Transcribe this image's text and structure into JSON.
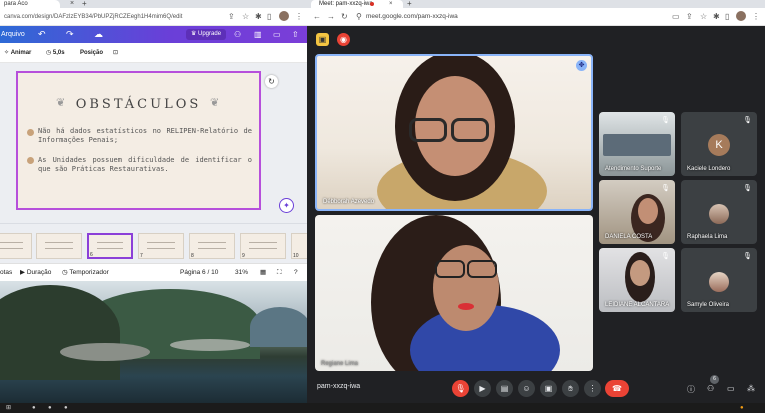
{
  "left_window": {
    "tab_title": "para Aco",
    "url": "canva.com/design/DAFzlzEYB34/PbUPZjRCZEegh1H4mim6Q/edit",
    "toolbar": {
      "file_label": "Arquivo",
      "upgrade_label": "Upgrade",
      "animate_label": "Animar",
      "duration_label": "5,0s",
      "position_label": "Posição"
    },
    "slide": {
      "title": "OBSTÁCULOS",
      "bullets": [
        "Não há dados estatísticos no RELIPEN-Relatório de Informações Penais;",
        "As Unidades possuem dificuldade de identificar o que são Práticas Restaurativas."
      ]
    },
    "thumbnails": [
      "5",
      "6",
      "7",
      "8",
      "9",
      "10"
    ],
    "bottom_bar": {
      "notes_label": "otas",
      "duration_label": "Duração",
      "timer_label": "Temporizador",
      "page_label": "Página 6 / 10",
      "zoom_label": "31%"
    }
  },
  "right_window": {
    "tab_title": "Meet: pam-xxzq-iwa",
    "url": "meet.google.com/pam-xxzq-iwa",
    "main_participants": [
      {
        "name": "Débborah Azevedo"
      },
      {
        "name": "Regiane Lima"
      }
    ],
    "grid_participants": [
      {
        "name": "Atendimento Suporte",
        "initial": ""
      },
      {
        "name": "Kaciele Londero",
        "initial": "K"
      },
      {
        "name": "DANIELA COSTA",
        "initial": ""
      },
      {
        "name": "Raphaela Lima",
        "initial": ""
      },
      {
        "name": "LEIDIANE ALCANTARA",
        "initial": ""
      },
      {
        "name": "Samyle Oliveira",
        "initial": ""
      }
    ],
    "meeting_code": "pam-xxzq-iwa",
    "participant_count": "6"
  },
  "colors": {
    "canva_purple": "#7b3ed8",
    "meet_dark": "#202124",
    "hangup_red": "#ea4335",
    "active_speaker_blue": "#8ab4f8"
  },
  "icons": [
    "back-icon",
    "forward-icon",
    "reload-icon",
    "star-icon",
    "extensions-icon",
    "mic-off-icon",
    "camera-icon",
    "captions-icon",
    "emoji-icon",
    "present-icon",
    "hand-icon",
    "more-icon",
    "hangup-icon",
    "info-icon",
    "people-icon",
    "chat-icon",
    "activities-icon"
  ]
}
